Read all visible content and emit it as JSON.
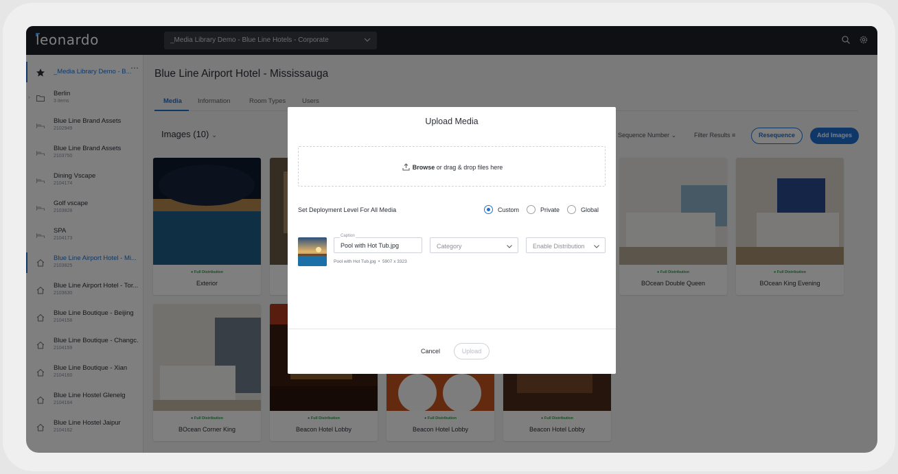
{
  "app": {
    "logo": "leonardo"
  },
  "workspace": {
    "label": "_Media Library Demo - Blue Line Hotels - Corporate"
  },
  "sidebar": {
    "items": [
      {
        "name": "_Media Library Demo - B...",
        "sub": "",
        "icon": "star-icon"
      },
      {
        "name": "Berlin",
        "sub": "3 items",
        "icon": "folder-icon"
      },
      {
        "name": "Blue Line Brand Assets",
        "sub": "2102949",
        "icon": "bed-icon"
      },
      {
        "name": "Blue Line Brand Assets",
        "sub": "2103750",
        "icon": "bed-icon"
      },
      {
        "name": "Dining Vscape",
        "sub": "2104174",
        "icon": "bed-icon"
      },
      {
        "name": "Golf vscape",
        "sub": "2103828",
        "icon": "bed-icon"
      },
      {
        "name": "SPA",
        "sub": "2104173",
        "icon": "bed-icon"
      },
      {
        "name": "Blue Line Airport Hotel - Mi...",
        "sub": "2103825",
        "icon": "home-icon"
      },
      {
        "name": "Blue Line Airport Hotel - Tor...",
        "sub": "2103630",
        "icon": "home-icon"
      },
      {
        "name": "Blue Line Boutique - Beijing",
        "sub": "2104158",
        "icon": "home-icon"
      },
      {
        "name": "Blue Line Boutique - Changc...",
        "sub": "2104159",
        "icon": "home-icon"
      },
      {
        "name": "Blue Line Boutique - Xian",
        "sub": "2104160",
        "icon": "home-icon"
      },
      {
        "name": "Blue Line Hostel Glenelg",
        "sub": "2104164",
        "icon": "home-icon"
      },
      {
        "name": "Blue Line Hostel Jaipur",
        "sub": "2104162",
        "icon": "home-icon"
      }
    ]
  },
  "main": {
    "title": "Blue Line Airport Hotel - Mississauga",
    "tabs": [
      "Media",
      "Information",
      "Room Types",
      "Users"
    ],
    "images_label": "Images (10)",
    "sort_label": "Sequence Number",
    "filter_label": "Filter Results",
    "resequence_label": "Resequence",
    "add_images_label": "Add Images",
    "cards": [
      {
        "caption": "Exterior",
        "distribution": "Full Distribution"
      },
      {
        "caption": "",
        "distribution": ""
      },
      {
        "caption": "",
        "distribution": ""
      },
      {
        "caption": "",
        "distribution": ""
      },
      {
        "caption": "BOcean Double Queen",
        "distribution": "Full Distribution"
      },
      {
        "caption": "BOcean King Evening",
        "distribution": "Full Distribution"
      },
      {
        "caption": "BOcean Corner King",
        "distribution": "Full Distribution"
      },
      {
        "caption": "Beacon Hotel Lobby",
        "distribution": "Full Distribution"
      },
      {
        "caption": "Beacon Hotel Lobby",
        "distribution": "Full Distribution"
      },
      {
        "caption": "Beacon Hotel Lobby",
        "distribution": "Full Distribution"
      }
    ]
  },
  "modal": {
    "title": "Upload Media",
    "browse": "Browse",
    "drop_text": " or drag & drop files here",
    "deploy_label": "Set Deployment Level For All Media",
    "options": [
      "Custom",
      "Private",
      "Global"
    ],
    "selected_option": "Custom",
    "caption_label": "Caption",
    "caption_value": "Pool with Hot Tub.jpg",
    "category_placeholder": "Category",
    "distribution_placeholder": "Enable Distribution",
    "file_name": "Pool with Hot Tub.jpg",
    "file_dims": "5907 x 3323",
    "cancel_label": "Cancel",
    "upload_label": "Upload"
  },
  "colors": {
    "accent": "#1f6fd1",
    "topbar": "#1d2026",
    "success": "#2e9b4a"
  }
}
